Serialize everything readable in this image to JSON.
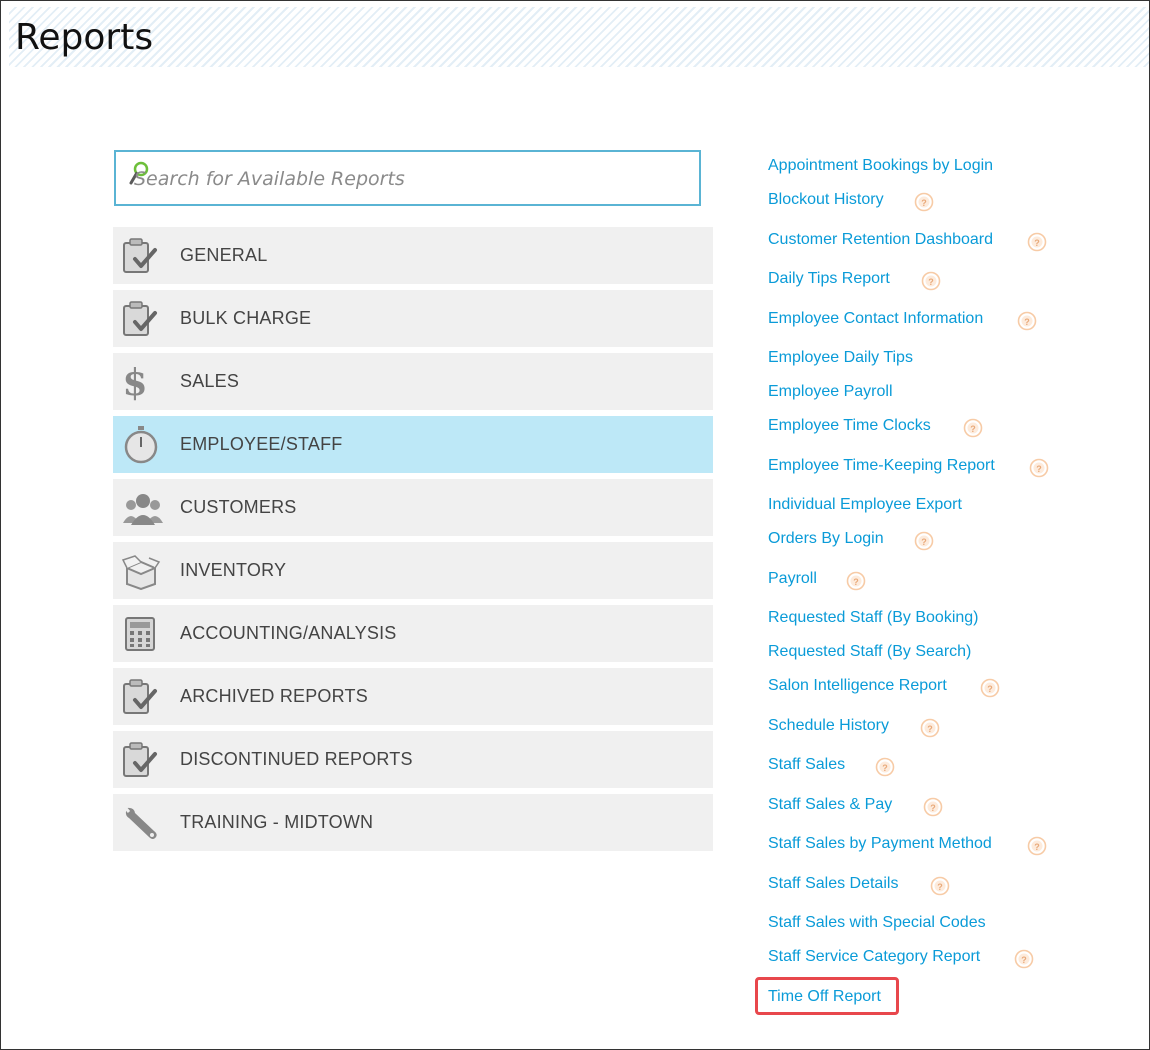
{
  "page": {
    "title": "Reports"
  },
  "search": {
    "placeholder": "Search for Available Reports",
    "value": ""
  },
  "categories": [
    {
      "label": "GENERAL",
      "icon": "clipboard-check-icon"
    },
    {
      "label": "BULK CHARGE",
      "icon": "clipboard-check-icon"
    },
    {
      "label": "SALES",
      "icon": "dollar-icon"
    },
    {
      "label": "EMPLOYEE/STAFF",
      "icon": "stopwatch-icon",
      "active": true
    },
    {
      "label": "CUSTOMERS",
      "icon": "people-icon"
    },
    {
      "label": "INVENTORY",
      "icon": "box-icon"
    },
    {
      "label": "ACCOUNTING/ANALYSIS",
      "icon": "calculator-icon"
    },
    {
      "label": "ARCHIVED REPORTS",
      "icon": "clipboard-check-icon"
    },
    {
      "label": "DISCONTINUED REPORTS",
      "icon": "clipboard-check-icon"
    },
    {
      "label": "TRAINING - MIDTOWN",
      "icon": "wrench-icon"
    }
  ],
  "reports": [
    {
      "label": "Appointment Bookings by Login",
      "help": false
    },
    {
      "label": "Blockout History",
      "help": true
    },
    {
      "label": "Customer Retention Dashboard",
      "help": true
    },
    {
      "label": "Daily Tips Report",
      "help": true
    },
    {
      "label": "Employee Contact Information",
      "help": true
    },
    {
      "label": "Employee Daily Tips",
      "help": false
    },
    {
      "label": "Employee Payroll",
      "help": false
    },
    {
      "label": "Employee Time Clocks",
      "help": true
    },
    {
      "label": "Employee Time-Keeping Report",
      "help": true
    },
    {
      "label": "Individual Employee Export",
      "help": false
    },
    {
      "label": "Orders By Login",
      "help": true
    },
    {
      "label": "Payroll",
      "help": true
    },
    {
      "label": "Requested Staff (By Booking)",
      "help": false
    },
    {
      "label": "Requested Staff (By Search)",
      "help": false
    },
    {
      "label": "Salon Intelligence Report",
      "help": true
    },
    {
      "label": "Schedule History",
      "help": true
    },
    {
      "label": "Staff Sales",
      "help": true
    },
    {
      "label": "Staff Sales & Pay",
      "help": true
    },
    {
      "label": "Staff Sales by Payment Method",
      "help": true
    },
    {
      "label": "Staff Sales Details",
      "help": true
    },
    {
      "label": "Staff Sales with Special Codes",
      "help": false
    },
    {
      "label": "Staff Service Category Report",
      "help": true
    },
    {
      "label": "Time Off Report",
      "help": false,
      "highlighted": true
    }
  ],
  "colors": {
    "link": "#0a9bd8",
    "active_category": "#bde8f7",
    "category_bg": "#f0f0f0",
    "highlight": "#e8474c",
    "help_icon": "#f7cba6"
  }
}
